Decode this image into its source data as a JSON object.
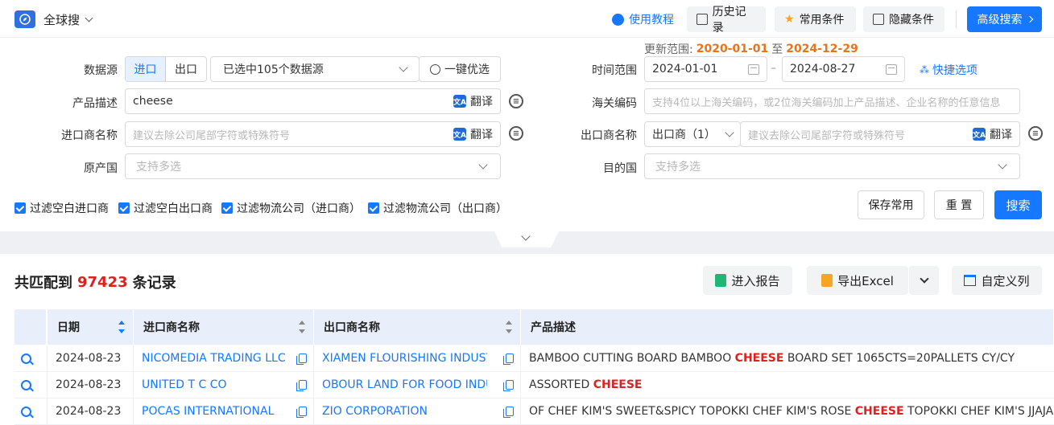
{
  "topbar": {
    "scope_label": "全球搜",
    "tutorial": "使用教程",
    "history": "历史记录",
    "common": "常用条件",
    "hide": "隐藏条件",
    "advanced": "高级搜索"
  },
  "update_range": {
    "label": "更新范围:",
    "start": "2020-01-01",
    "sep": "至",
    "end": "2024-12-29"
  },
  "filters": {
    "datasource_label": "数据源",
    "import_label": "进口",
    "export_label": "出口",
    "datasource_value": "已选中105个数据源",
    "one_click": "一键优选",
    "product_label": "产品描述",
    "product_value": "cheese",
    "translate": "翻译",
    "importer_label": "进口商名称",
    "importer_placeholder": "建议去除公司尾部字符或特殊符号",
    "origin_label": "原产国",
    "origin_placeholder": "支持多选",
    "time_label": "时间范围",
    "date_start": "2024-01-01",
    "date_dash": "–",
    "date_end": "2024-08-27",
    "quick_options": "快捷选项",
    "hscode_label": "海关编码",
    "hscode_placeholder": "支持4位以上海关编码，或2位海关编码加上产品描述、企业名称的任意信息",
    "exporter_label": "出口商名称",
    "exporter_type": "出口商（1）",
    "exporter_placeholder": "建议去除公司尾部字符或特殊符号",
    "dest_label": "目的国",
    "dest_placeholder": "支持多选"
  },
  "checks": [
    "过滤空白进口商",
    "过滤空白出口商",
    "过滤物流公司（进口商）",
    "过滤物流公司（出口商）"
  ],
  "actions": {
    "save": "保存常用",
    "reset": "重 置",
    "search": "搜索"
  },
  "results": {
    "prefix": "共匹配到",
    "count": "97423",
    "suffix": "条记录",
    "report": "进入报告",
    "export": "导出Excel",
    "custom_cols": "自定义列"
  },
  "table": {
    "headers": [
      "日期",
      "进口商名称",
      "出口商名称",
      "产品描述"
    ],
    "rows": [
      {
        "date": "2024-08-23",
        "importer": "NICOMEDIA TRADING LLC",
        "exporter": "XIAMEN FLOURISHING INDUST",
        "desc_pre": "BAMBOO CUTTING BOARD BAMBOO ",
        "desc_kw": "CHEESE",
        "desc_post": " BOARD SET 1065CTS=20PALLETS CY/CY"
      },
      {
        "date": "2024-08-23",
        "importer": "UNITED T C CO",
        "exporter": "OBOUR LAND FOR FOOD INDU",
        "desc_pre": "ASSORTED ",
        "desc_kw": "CHEESE",
        "desc_post": ""
      },
      {
        "date": "2024-08-23",
        "importer": "POCAS INTERNATIONAL",
        "exporter": "ZIO CORPORATION",
        "desc_pre": "OF CHEF KIM'S SWEET&SPICY TOPOKKI CHEF KIM'S ROSE ",
        "desc_kw": "CHEESE",
        "desc_post": " TOPOKKI CHEF KIM'S JJAJANG T"
      }
    ]
  },
  "colors": {
    "accent": "#1677ff",
    "highlight": "#e02020",
    "update_date": "#e8731a"
  }
}
